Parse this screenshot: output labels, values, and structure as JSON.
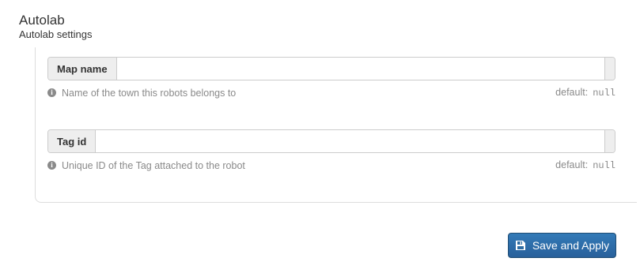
{
  "header": {
    "title": "Autolab",
    "subtitle": "Autolab settings"
  },
  "fields": [
    {
      "label": "Map name",
      "value": "",
      "help": "Name of the town this robots belongs to",
      "default_label": "default:",
      "default_value": "null"
    },
    {
      "label": "Tag id",
      "value": "",
      "help": "Unique ID of the Tag attached to the robot",
      "default_label": "default:",
      "default_value": "null"
    }
  ],
  "actions": {
    "save_label": "Save and Apply"
  },
  "icons": {
    "info": "info-circle-icon",
    "save": "save-floppy-icon"
  },
  "colors": {
    "primary": "#337ab7",
    "addon_bg": "#eeeeee",
    "help_text": "#8a8a8a"
  }
}
